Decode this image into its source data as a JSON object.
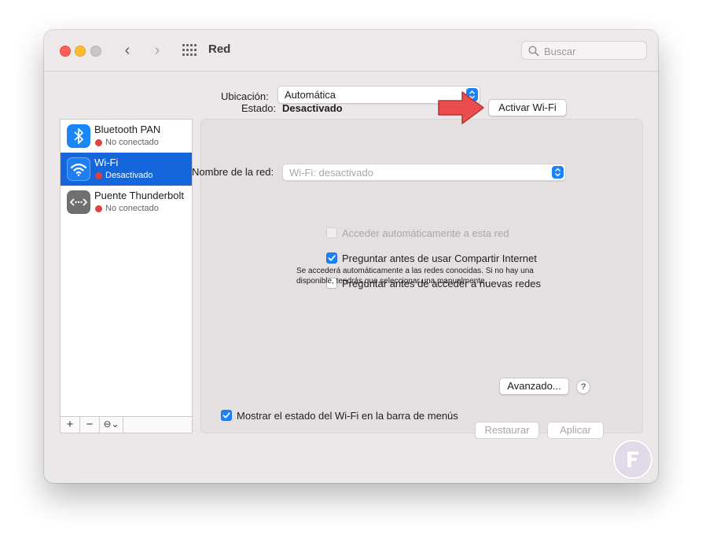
{
  "window": {
    "title": "Red"
  },
  "search": {
    "placeholder": "Buscar"
  },
  "location": {
    "label": "Ubicación:",
    "value": "Automática"
  },
  "services": [
    {
      "name": "Bluetooth PAN",
      "status": "No conectado",
      "icon": "bluetooth-icon",
      "selected": false
    },
    {
      "name": "Wi-Fi",
      "status": "Desactivado",
      "icon": "wifi-icon",
      "selected": true
    },
    {
      "name": "Puente Thunderbolt",
      "status": "No conectado",
      "icon": "thunderbolt-bridge-icon",
      "selected": false
    }
  ],
  "sidebar_bar": {
    "add": "+",
    "remove": "−",
    "action": "⊖⌄"
  },
  "detail": {
    "status_label": "Estado:",
    "status_value": "Desactivado",
    "turn_on_button": "Activar Wi-Fi",
    "network_name_label": "Nombre de la red:",
    "network_name_placeholder": "Wi-Fi: desactivado",
    "options": [
      {
        "label": "Acceder automáticamente a esta red",
        "checked": false,
        "disabled": true
      },
      {
        "label": "Preguntar antes de usar Compartir Internet",
        "checked": true,
        "disabled": false
      },
      {
        "label": "Preguntar antes de acceder a nuevas redes",
        "checked": false,
        "disabled": false
      }
    ],
    "help_text": "Se accederá automáticamente a las redes conocidas. Si no hay una disponible, tendrás que seleccionar una manualmente.",
    "show_status_label": "Mostrar el estado del Wi-Fi en la barra de menús",
    "show_status_checked": true,
    "advanced_button": "Avanzado...",
    "help_button": "?"
  },
  "footer": {
    "revert_button": "Restaurar",
    "apply_button": "Aplicar"
  },
  "colors": {
    "accent": "#1a82fb",
    "selection": "#1565db",
    "status_red": "#e3403d",
    "arrow": "#e94d4d"
  }
}
